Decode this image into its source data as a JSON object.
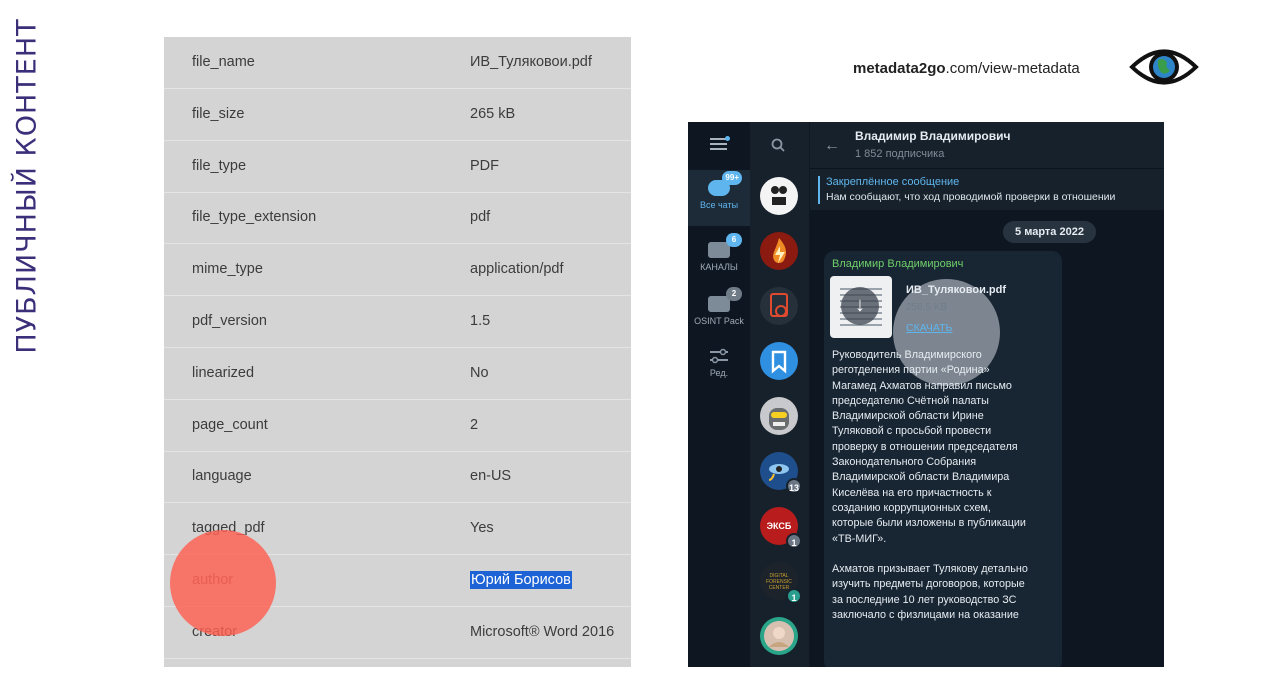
{
  "side_title": "ПУБЛИЧНЫЙ КОНТЕНТ",
  "metadata_rows": [
    {
      "key": "file_name",
      "value": "ИВ_Туляковои.pdf"
    },
    {
      "key": "file_size",
      "value": "265 kB"
    },
    {
      "key": "file_type",
      "value": "PDF"
    },
    {
      "key": "file_type_extension",
      "value": "pdf"
    },
    {
      "key": "mime_type",
      "value": "application/pdf"
    },
    {
      "key": "pdf_version",
      "value": "1.5"
    },
    {
      "key": "linearized",
      "value": "No"
    },
    {
      "key": "page_count",
      "value": "2"
    },
    {
      "key": "language",
      "value": "en-US"
    },
    {
      "key": "tagged_pdf",
      "value": "Yes"
    },
    {
      "key": "author",
      "value": "Юрий Борисов",
      "selected": true
    },
    {
      "key": "creator",
      "value": "Microsoft® Word 2016"
    }
  ],
  "url": {
    "domain": "metadata2go",
    "path": ".com/view-metadata"
  },
  "icons": {
    "eye": "eye-icon",
    "menu": "menu-icon",
    "search": "search-icon",
    "back": "back-arrow-icon",
    "download": "download-icon"
  },
  "telegram": {
    "folders": [
      {
        "label": "Все чаты",
        "badge": "99+",
        "active": true
      },
      {
        "label": "КАНАЛЫ",
        "badge": "6"
      },
      {
        "label": "OSINT Pack",
        "badge": "2"
      },
      {
        "label": "Ред."
      }
    ],
    "chat_badges": [
      "13",
      "1",
      "1"
    ],
    "chat_avatar_texts": {
      "third_avatar": "ЭКСБ",
      "fourth_avatar": "DIGITAL FORENSIC CENTER"
    },
    "channel": {
      "title": "Владимир Владимирович",
      "subscribers": "1 852 подписчика"
    },
    "pinned": {
      "label": "Закреплённое сообщение",
      "text": "Нам сообщают, что ход проводимой проверки в отношении"
    },
    "date": "5 марта 2022",
    "message": {
      "sender": "Владимир Владимирович",
      "file_name": "ИВ_Туляковои.pdf",
      "file_size": "256.5 KB",
      "download_label": "СКАЧАТЬ",
      "text": "Руководитель Владимирского\nреготделения партии «Родина»\nМагамед Ахматов направил письмо\nпредседателю Счётной палаты\nВладимирской области Ирине\nТуляковой с просьбой провести\nпроверку в отношении председателя\nЗаконодательного Собрания\nВладимирской области Владимира\nКиселёва на его причастность к\nсозданию коррупционных схем,\nкоторые были изложены в публикации\n«ТВ-МИГ».\n\nАхматов призывает Тулякову детально\nизучить предметы договоров, которые\nза последние 10 лет руководство ЗС\nзаключало с физлицами на оказание"
    }
  },
  "colors": {
    "accent": "#5fb6ef",
    "highlight": "#1e63d6",
    "red_marker": "#ff5f50",
    "side_title": "#3b2f7a"
  }
}
